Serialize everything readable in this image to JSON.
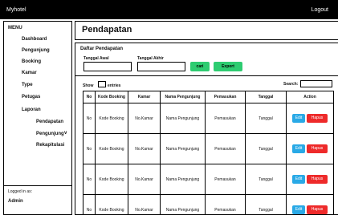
{
  "topbar": {
    "brand": "Myhotel",
    "logout": "Logout"
  },
  "sidebar": {
    "menu_title": "MENU",
    "items": [
      "Dashboard",
      "Pengunjung",
      "Booking",
      "Kamar",
      "Type",
      "Petugas",
      "Laporan"
    ],
    "sub_items": [
      "Pendapatan",
      "Pengunjung",
      "Rekapitulasi"
    ],
    "logged_label": "Logged in as:",
    "user": "Admin"
  },
  "page": {
    "title": "Pendapatan"
  },
  "filter": {
    "section_title": "Daftar Pendapatan",
    "awal_label": "Tanggal Awal",
    "akhir_label": "Tanggal Akhir",
    "cari": "cari",
    "export": "Export"
  },
  "table_controls": {
    "show": "Show",
    "entries": "entries",
    "search": "Search:"
  },
  "table": {
    "columns": [
      "No",
      "Kode Booking",
      "Kamar",
      "Nama Pengunjung",
      "Pemasukan",
      "Tanggal",
      "Action"
    ],
    "rows": [
      {
        "no": "No",
        "kode": "Kode Booking",
        "kamar": "No.Kamar",
        "nama": "Nama Pengunjung",
        "pemasukan": "Pemasukan",
        "tanggal": "Tanggal",
        "edit": "Edit",
        "hapus": "Hapus"
      },
      {
        "no": "No",
        "kode": "Kode Booking",
        "kamar": "No.Kamar",
        "nama": "Nama Pengunjung",
        "pemasukan": "Pemasukan",
        "tanggal": "Tanggal",
        "edit": "Edit",
        "hapus": "Hapus"
      },
      {
        "no": "No",
        "kode": "Kode Booking",
        "kamar": "No.Kamar",
        "nama": "Nama Pengunjung",
        "pemasukan": "Pemasukan",
        "tanggal": "Tanggal",
        "edit": "Edit",
        "hapus": "Hapus"
      },
      {
        "no": "No",
        "kode": "Kode Booking",
        "kamar": "No.Kamar",
        "nama": "Nama Pengunjung",
        "pemasukan": "Pemasukan",
        "tanggal": "Tanggal",
        "edit": "Edit",
        "hapus": "Hapus"
      }
    ]
  },
  "colors": {
    "topbar": "#000000",
    "green_button": "#2ecc71",
    "edit_button": "#29a9e6",
    "hapus_button": "#ee2a2a"
  }
}
